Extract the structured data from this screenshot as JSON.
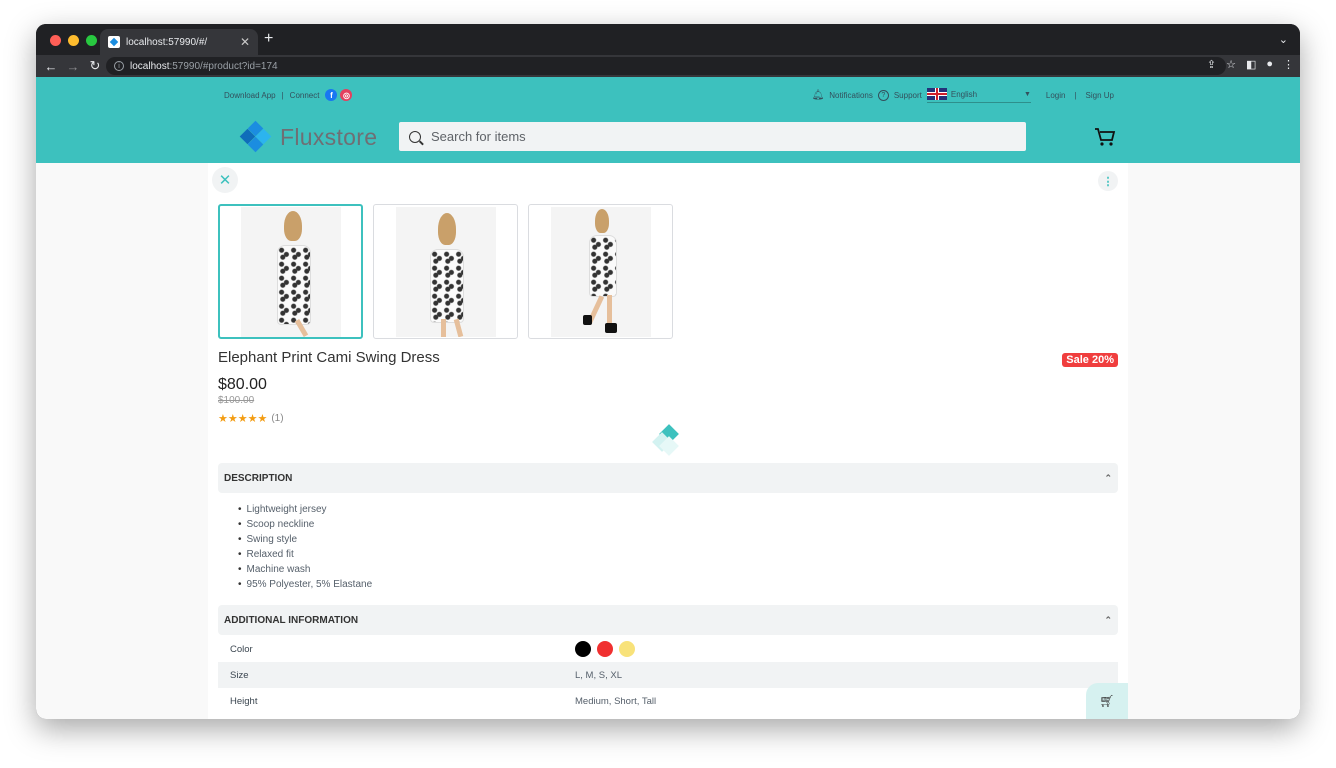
{
  "browser": {
    "tab_title": "localhost:57990/#/",
    "url_host": "localhost",
    "url_rest": ":57990/#product?id=174",
    "traffic_lights": [
      "#ff5f57",
      "#febc2e",
      "#28c840"
    ]
  },
  "topbar": {
    "download_app": "Download App",
    "separator": "|",
    "connect": "Connect",
    "social": [
      {
        "name": "facebook",
        "glyph": "f",
        "color": "#1877f2"
      },
      {
        "name": "instagram",
        "glyph": "◎",
        "color": "#e4405f"
      }
    ],
    "notifications": "Notifications",
    "support": "Support",
    "language": "English",
    "login": "Login",
    "signup": "Sign Up"
  },
  "brand": {
    "name": "Fluxstore",
    "colors": {
      "primary": "#3dc1be",
      "logo_dark": "#0f6dba",
      "logo_mid": "#1b8de0",
      "logo_light": "#2cb4ef"
    }
  },
  "search": {
    "placeholder": "Search for items"
  },
  "product": {
    "title": "Elephant Print Cami Swing Dress",
    "price": "$80.00",
    "regular_price": "$100.00",
    "sale_badge": "Sale 20%",
    "stars": "★★★★★",
    "rating": 5,
    "review_count": "(1)",
    "images": [
      "front view",
      "back view",
      "side view with boots"
    ],
    "selected_image": 0
  },
  "description": {
    "heading": "Description",
    "items": [
      "Lightweight jersey",
      "Scoop neckline",
      "Swing style",
      "Relaxed fit",
      "Machine wash",
      "95% Polyester, 5% Elastane"
    ]
  },
  "additional": {
    "heading": "Additional Information",
    "color_label": "Color",
    "colors": [
      "#000000",
      "#f03030",
      "#f8e27a"
    ],
    "size_label": "Size",
    "size_value": "L, M, S, XL",
    "height_label": "Height",
    "height_value": "Medium, Short, Tall"
  }
}
